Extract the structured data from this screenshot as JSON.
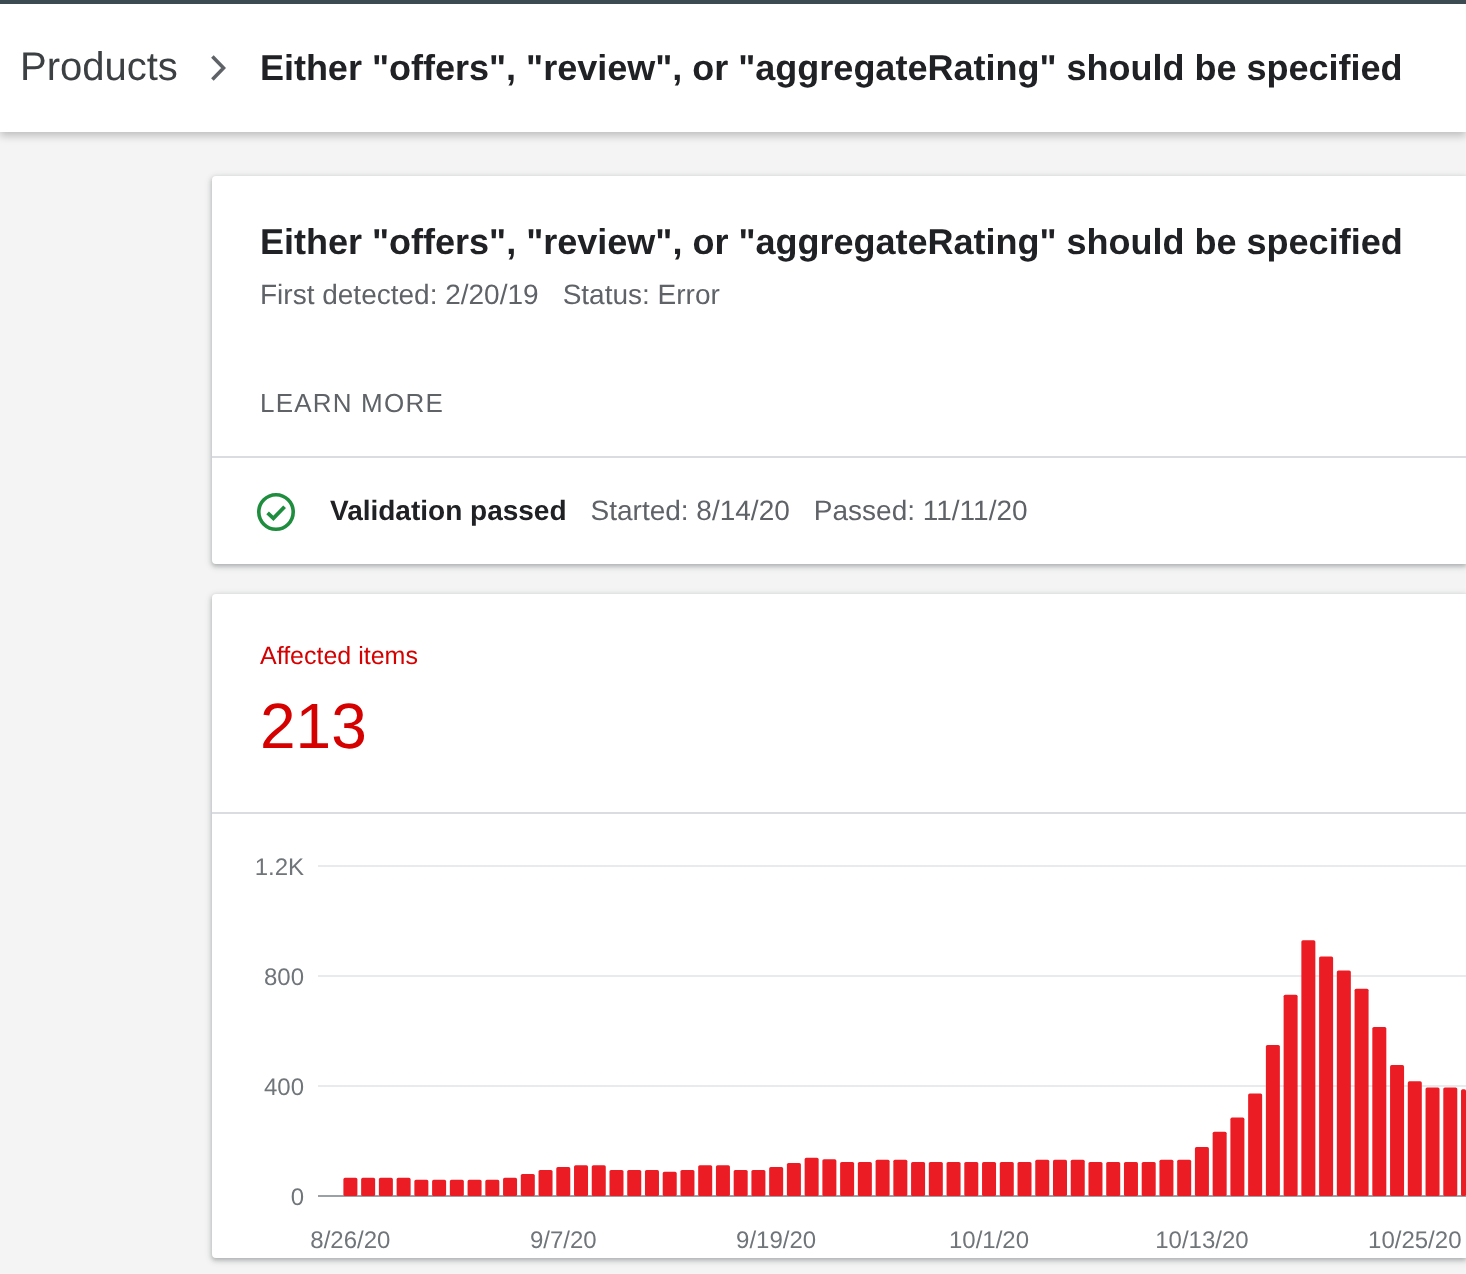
{
  "breadcrumb": {
    "items": [
      {
        "label": "Products",
        "current": false
      },
      {
        "label": "Either \"offers\", \"review\", or \"aggregateRating\" should be specified",
        "current": true
      }
    ]
  },
  "issue_card": {
    "title": "Either \"offers\", \"review\", or \"aggregateRating\" should be specified",
    "first_detected": "First detected: 2/20/19",
    "status": "Status: Error",
    "learn_more": "LEARN MORE",
    "validation": {
      "passed": true,
      "label": "Validation passed",
      "started": "Started: 8/14/20",
      "passed_date": "Passed: 11/11/20"
    }
  },
  "affected_card": {
    "label": "Affected items",
    "count": "213",
    "chart_data": {
      "type": "bar",
      "categories": [
        "8/26/20",
        null,
        null,
        null,
        null,
        null,
        null,
        null,
        null,
        null,
        null,
        null,
        "9/7/20",
        null,
        null,
        null,
        null,
        null,
        null,
        null,
        null,
        null,
        null,
        null,
        "9/19/20",
        null,
        null,
        null,
        null,
        null,
        null,
        null,
        null,
        null,
        null,
        null,
        "10/1/20",
        null,
        null,
        null,
        null,
        null,
        null,
        null,
        null,
        null,
        null,
        null,
        "10/13/20",
        null,
        null,
        null,
        null,
        null,
        null,
        null,
        null,
        null,
        null,
        null,
        "10/25/20",
        null,
        null,
        null
      ],
      "series": [
        {
          "color": "#ec1c24",
          "values": [
            66,
            66,
            66,
            66,
            59,
            59,
            59,
            59,
            59,
            66,
            80,
            95,
            105,
            112,
            112,
            95,
            95,
            95,
            88,
            95,
            112,
            112,
            95,
            95,
            105,
            120,
            139,
            134,
            124,
            124,
            132,
            132,
            124,
            124,
            124,
            124,
            124,
            124,
            124,
            132,
            132,
            132,
            124,
            124,
            124,
            124,
            132,
            132,
            178,
            234,
            285,
            373,
            549,
            732,
            930,
            871,
            820,
            754,
            615,
            476,
            417,
            395,
            395,
            388
          ]
        }
      ],
      "ylim": [
        0,
        1200
      ],
      "yticks": [
        0,
        400,
        800,
        {
          "value": 1200,
          "label": "1.2K"
        }
      ]
    }
  }
}
